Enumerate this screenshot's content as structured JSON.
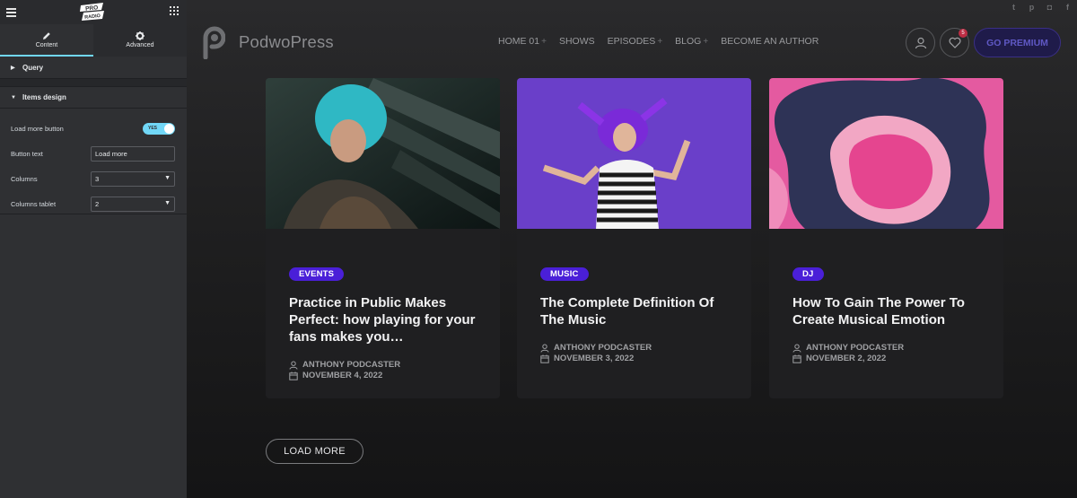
{
  "editor": {
    "tabs": [
      {
        "label": "Content",
        "icon": "pencil-icon"
      },
      {
        "label": "Advanced",
        "icon": "gear-icon"
      }
    ],
    "sections": {
      "query": "Query",
      "items_design": "Items design"
    },
    "controls": {
      "load_more_label": "Load more button",
      "toggle_state": "YES",
      "button_text_label": "Button text",
      "button_text_value": "Load more",
      "columns_label": "Columns",
      "columns_value": "3",
      "columns_tablet_label": "Columns tablet",
      "columns_tablet_value": "2"
    },
    "accent": "#71d7f7"
  },
  "site": {
    "brand": "PodwoPress",
    "nav": [
      {
        "label": "HOME 01",
        "has_plus": true
      },
      {
        "label": "SHOWS",
        "has_plus": false
      },
      {
        "label": "EPISODES",
        "has_plus": true
      },
      {
        "label": "BLOG",
        "has_plus": true
      },
      {
        "label": "BECOME AN AUTHOR",
        "has_plus": false
      }
    ],
    "plus_symbol": "+",
    "favorites_count": "5",
    "premium_button": "GO PREMIUM",
    "social_icons": [
      "twitter-icon",
      "pinterest-icon",
      "instagram-icon",
      "facebook-icon"
    ]
  },
  "cards": [
    {
      "tag": "EVENTS",
      "title": "Practice in Public Makes Perfect: how playing for your fans makes you…",
      "author": "ANTHONY PODCASTER",
      "date": "NOVEMBER 4, 2022"
    },
    {
      "tag": "MUSIC",
      "title": "The Complete Definition Of The Music",
      "author": "ANTHONY PODCASTER",
      "date": "NOVEMBER 3, 2022"
    },
    {
      "tag": "DJ",
      "title": "How To Gain The Power To Create Musical Emotion",
      "author": "ANTHONY PODCASTER",
      "date": "NOVEMBER 2, 2022"
    }
  ],
  "load_more_button": "LOAD MORE",
  "tag_color": "#4a1fd8"
}
